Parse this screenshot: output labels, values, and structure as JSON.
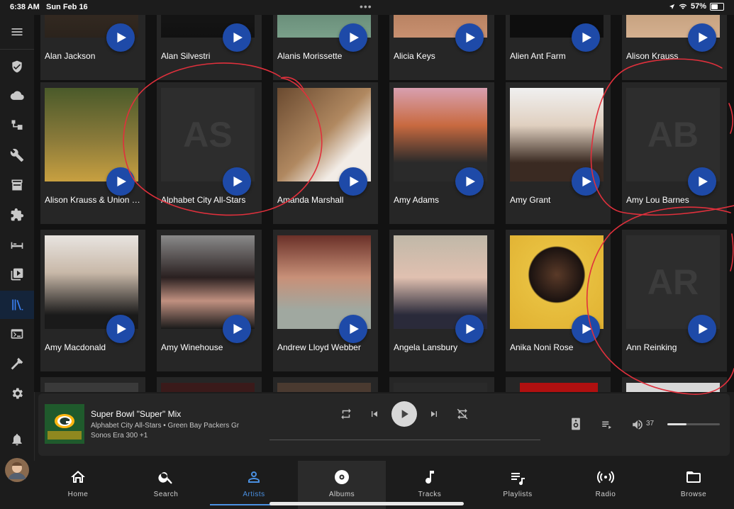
{
  "status_bar": {
    "time": "6:38 AM",
    "date": "Sun Feb 16",
    "battery": "57%",
    "battery_level": 0.57,
    "dots": "•••"
  },
  "sidebar": {
    "items": [
      {
        "icon": "menu-icon"
      },
      {
        "icon": "shield-icon"
      },
      {
        "icon": "cloud-icon"
      },
      {
        "icon": "network-icon"
      },
      {
        "icon": "wrench-icon"
      },
      {
        "icon": "hacs-icon"
      },
      {
        "icon": "puzzle-icon"
      },
      {
        "icon": "bed-icon"
      },
      {
        "icon": "media-icon"
      },
      {
        "icon": "library-icon"
      },
      {
        "icon": "terminal-icon"
      },
      {
        "icon": "hammer-icon"
      },
      {
        "icon": "gear-icon"
      },
      {
        "icon": "bell-icon"
      },
      {
        "icon": "avatar"
      }
    ]
  },
  "artists": [
    {
      "name": "Alan Jackson"
    },
    {
      "name": "Alan Silvestri"
    },
    {
      "name": "Alanis Morissette"
    },
    {
      "name": "Alicia Keys"
    },
    {
      "name": "Alien Ant Farm"
    },
    {
      "name": "Alison Krauss"
    },
    {
      "name": "Alison Krauss & Union Station"
    },
    {
      "name": "Alphabet City All-Stars",
      "initials": "AS"
    },
    {
      "name": "Amanda Marshall"
    },
    {
      "name": "Amy Adams"
    },
    {
      "name": "Amy Grant"
    },
    {
      "name": "Amy Lou Barnes",
      "initials": "AB"
    },
    {
      "name": "Amy Macdonald"
    },
    {
      "name": "Amy Winehouse"
    },
    {
      "name": "Andrew Lloyd Webber"
    },
    {
      "name": "Angela Lansbury"
    },
    {
      "name": "Anika Noni Rose"
    },
    {
      "name": "Ann Reinking",
      "initials": "AR"
    }
  ],
  "player": {
    "title": "Super Bowl \"Super\" Mix",
    "subtitle": "Alphabet City All-Stars • Green Bay Packers Gr",
    "device": "Sonos Era 300 +1",
    "volume": "37",
    "volume_level": 0.37
  },
  "tabs": [
    {
      "label": "Home",
      "icon": "home-icon"
    },
    {
      "label": "Search",
      "icon": "search-icon"
    },
    {
      "label": "Artists",
      "icon": "person-icon"
    },
    {
      "label": "Albums",
      "icon": "disc-icon"
    },
    {
      "label": "Tracks",
      "icon": "music-note-icon"
    },
    {
      "label": "Playlists",
      "icon": "playlist-icon"
    },
    {
      "label": "Radio",
      "icon": "radio-icon"
    },
    {
      "label": "Browse",
      "icon": "folder-icon"
    }
  ],
  "colors": {
    "accent": "#4a90e2",
    "play_button": "#1e4aa8",
    "annotation": "#e0303c"
  }
}
